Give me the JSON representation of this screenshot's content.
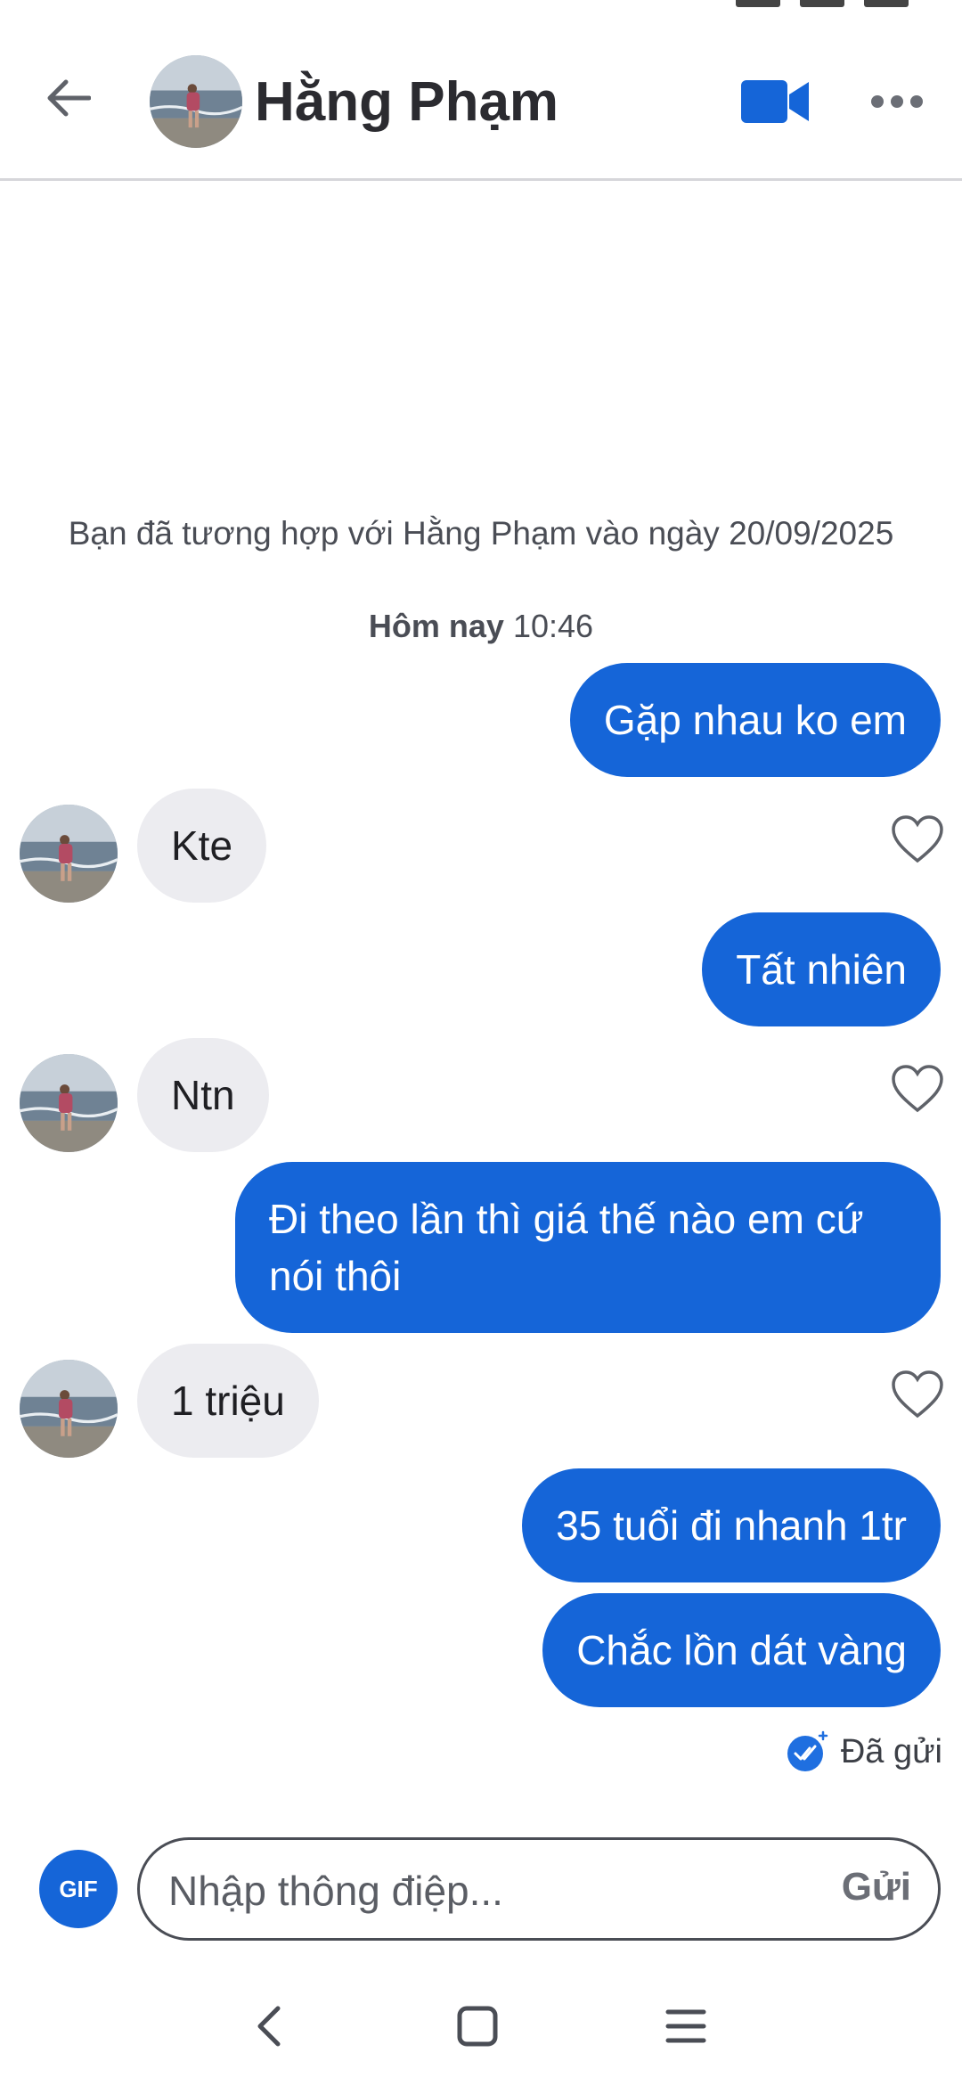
{
  "header": {
    "contact_name": "Hằng Phạm"
  },
  "chat": {
    "match_note": "Bạn đã tương hợp với Hằng Phạm vào ngày 20/09/2025",
    "day_label": "Hôm nay",
    "day_time": "10:46",
    "messages": [
      {
        "direction": "out",
        "text": "Gặp nhau ko em"
      },
      {
        "direction": "in",
        "text": "Kte"
      },
      {
        "direction": "out",
        "text": "Tất nhiên"
      },
      {
        "direction": "in",
        "text": "Ntn"
      },
      {
        "direction": "out",
        "text": "Đi theo lần thì giá thế nào em cứ nói thôi"
      },
      {
        "direction": "in",
        "text": "1 triệu"
      },
      {
        "direction": "out",
        "text": "35 tuổi đi nhanh 1tr"
      },
      {
        "direction": "out",
        "text": "Chắc lồn dát vàng"
      }
    ],
    "sent_status": "Đã gửi"
  },
  "composer": {
    "gif_label": "GIF",
    "placeholder": "Nhập thông điệp...",
    "send_label": "Gửi"
  },
  "icons": {
    "back": "arrow-left-icon",
    "video": "video-camera-icon",
    "more": "more-horizontal-icon",
    "like": "heart-outline-icon",
    "sent": "double-check-icon",
    "nav_back": "chevron-left-icon",
    "nav_home": "square-icon",
    "nav_menu": "menu-icon"
  },
  "colors": {
    "accent": "#1565d8",
    "incoming_bubble": "#ececf0",
    "text_secondary": "#4a4d55"
  }
}
